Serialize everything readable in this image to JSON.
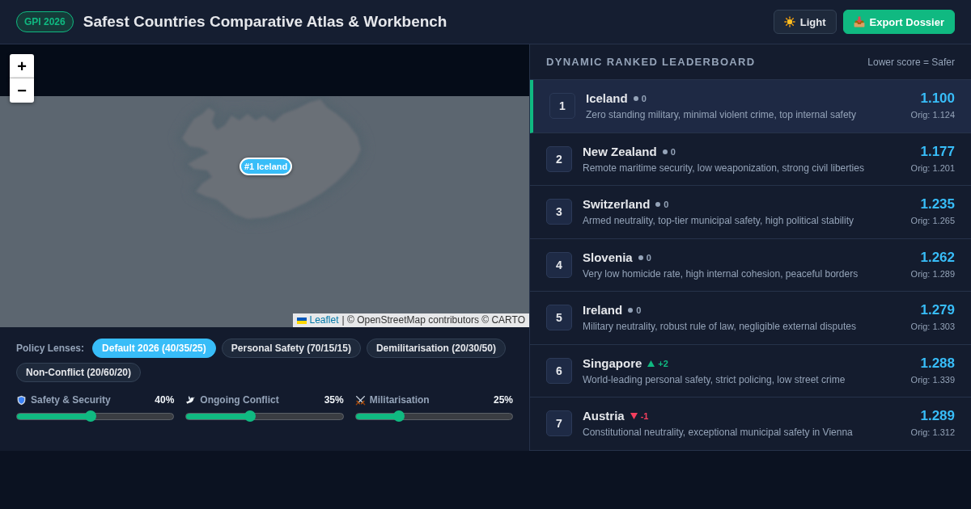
{
  "header": {
    "badge": "GPI 2026",
    "title": "Safest Countries Comparative Atlas & Workbench",
    "buttons": [
      {
        "kind": "theme",
        "label": "Light"
      },
      {
        "kind": "export",
        "label": "Export Dossier"
      }
    ]
  },
  "map": {
    "zoom_controls": [
      "+",
      "−"
    ],
    "marker": "#1 Iceland",
    "attribution": {
      "link": "Leaflet",
      "text": "| © OpenStreetMap contributors © CARTO"
    }
  },
  "lenses": {
    "label": "Policy Lenses:",
    "items": [
      {
        "label": "Default 2026 (40/35/25)",
        "selected": true
      },
      {
        "label": "Personal Safety (70/15/15)",
        "selected": false
      },
      {
        "label": "Demilitarisation (20/30/50)",
        "selected": false
      },
      {
        "label": "Non-Conflict (20/60/20)",
        "selected": false
      }
    ]
  },
  "sliders": [
    {
      "kind": "safety",
      "label": "Safety & Security",
      "reading": "40%",
      "level": 0.47
    },
    {
      "kind": "conflict",
      "label": "Ongoing Conflict",
      "reading": "35%",
      "level": 0.41
    },
    {
      "kind": "militarisation",
      "label": "Militarisation",
      "reading": "25%",
      "level": 0.28
    }
  ],
  "leaderboard": {
    "title": "DYNAMIC RANKED LEADERBOARD",
    "note": "Lower score = Safer",
    "rows": [
      {
        "rank": "1",
        "name": "Iceland",
        "change": {
          "kind": "same",
          "text": "0"
        },
        "description": "Zero standing military, minimal violent crime, top internal safety",
        "score": "1.100",
        "original": "Orig: 1.124",
        "selected": true
      },
      {
        "rank": "2",
        "name": "New Zealand",
        "change": {
          "kind": "same",
          "text": "0"
        },
        "description": "Remote maritime security, low weaponization, strong civil liberties",
        "score": "1.177",
        "original": "Orig: 1.201",
        "selected": false
      },
      {
        "rank": "3",
        "name": "Switzerland",
        "change": {
          "kind": "same",
          "text": "0"
        },
        "description": "Armed neutrality, top-tier municipal safety, high political stability",
        "score": "1.235",
        "original": "Orig: 1.265",
        "selected": false
      },
      {
        "rank": "4",
        "name": "Slovenia",
        "change": {
          "kind": "same",
          "text": "0"
        },
        "description": "Very low homicide rate, high internal cohesion, peaceful borders",
        "score": "1.262",
        "original": "Orig: 1.289",
        "selected": false
      },
      {
        "rank": "5",
        "name": "Ireland",
        "change": {
          "kind": "same",
          "text": "0"
        },
        "description": "Military neutrality, robust rule of law, negligible external disputes",
        "score": "1.279",
        "original": "Orig: 1.303",
        "selected": false
      },
      {
        "rank": "6",
        "name": "Singapore",
        "change": {
          "kind": "up",
          "text": "+2"
        },
        "description": "World-leading personal safety, strict policing, low street crime",
        "score": "1.288",
        "original": "Orig: 1.339",
        "selected": false
      },
      {
        "rank": "7",
        "name": "Austria",
        "change": {
          "kind": "down",
          "text": "-1"
        },
        "description": "Constitutional neutrality, exceptional municipal safety in Vienna",
        "score": "1.289",
        "original": "Orig: 1.312",
        "selected": false
      }
    ]
  }
}
